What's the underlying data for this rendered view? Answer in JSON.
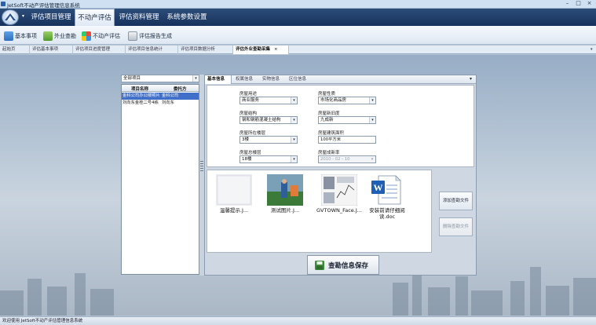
{
  "window": {
    "title": "JetSoft不动产评估管理信息系统"
  },
  "ribbon": {
    "tabs": [
      {
        "label": "评估项目管理"
      },
      {
        "label": "不动产评估"
      },
      {
        "label": "评估资料管理"
      },
      {
        "label": "系统参数设置"
      }
    ],
    "buttons": [
      {
        "label": "基本事项"
      },
      {
        "label": "外业查勘"
      },
      {
        "label": "不动产评估"
      },
      {
        "label": "评估报告生成"
      }
    ]
  },
  "doc_tabs": [
    "起始页",
    "评估基本事项",
    "评估项目进度管理",
    "评估项目信息统计",
    "评估项目数据分析",
    "评估外业查勘采集"
  ],
  "doc_tab_close": "×",
  "left": {
    "filter": "全部项目",
    "columns": [
      "项目名称",
      "委托方"
    ],
    "rows": [
      [
        "金科公司办公楼照片",
        "金科公司"
      ],
      [
        "刘向东金桂二号4栋",
        "刘向东"
      ]
    ]
  },
  "inner_tabs": [
    "基本信息",
    "权属信息",
    "实物信息",
    "区位信息"
  ],
  "form": {
    "usage": {
      "label": "房屋用途",
      "value": "商业服务"
    },
    "nature": {
      "label": "房屋性质",
      "value": "市场化商品房"
    },
    "structure": {
      "label": "房屋结构",
      "value": "钢和钢筋混凝土结构"
    },
    "condition": {
      "label": "房屋新旧度",
      "value": "九成新"
    },
    "floor": {
      "label": "房屋所在楼层",
      "value": "3楼"
    },
    "area": {
      "label": "房屋建筑面积",
      "value": "100平方米"
    },
    "total_floors": {
      "label": "房屋总楼层",
      "value": "18楼"
    },
    "built_year": {
      "label": "房屋成新率",
      "value": "2010 - 02 - 10"
    }
  },
  "files": [
    {
      "name": "温馨提示.J..."
    },
    {
      "name": "测试图片.J..."
    },
    {
      "name": "GVTOWN_Face.J..."
    },
    {
      "name": "安装前请仔细阅读.doc"
    }
  ],
  "side_buttons": {
    "add": "添加查勘文件",
    "delete": "删除查勘文件"
  },
  "save_button": "查勘信息保存",
  "status": "欢迎使用 JetSoft不动产评估管理信息系统"
}
